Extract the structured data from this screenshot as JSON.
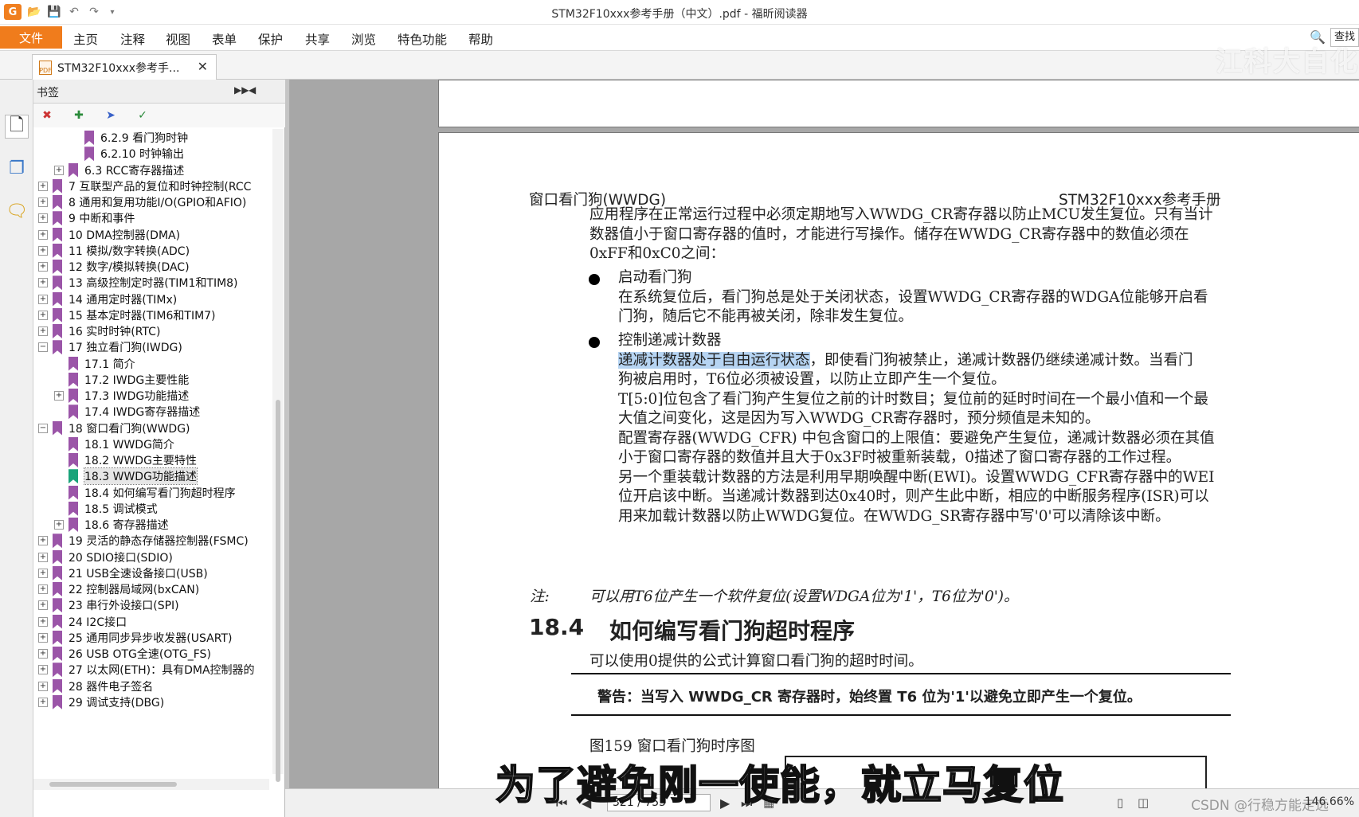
{
  "titlebar": {
    "app_icon": "G",
    "window_title": "STM32F10xxx参考手册（中文）.pdf - 福昕阅读器",
    "quick_access": [
      "open-folder-icon",
      "save-icon",
      "undo-icon",
      "redo-icon",
      "customize-icon"
    ]
  },
  "ribbon": {
    "file_tab": "文件",
    "tabs": [
      "主页",
      "注释",
      "视图",
      "表单",
      "保护",
      "共享",
      "浏览",
      "特色功能",
      "帮助"
    ],
    "search_label": "查找"
  },
  "doc_tab": {
    "title": "STM32F10xxx参考手...",
    "close": "✕"
  },
  "watermark_top": "江科大自化",
  "bookmarks": {
    "header": "书签",
    "items": [
      {
        "label": "6.2.9 看门狗时钟",
        "level": 3,
        "expandable": false
      },
      {
        "label": "6.2.10 时钟输出",
        "level": 3,
        "expandable": false
      },
      {
        "label": "6.3 RCC寄存器描述",
        "level": 2,
        "expandable": true
      },
      {
        "label": "7 互联型产品的复位和时钟控制(RCC",
        "level": 1,
        "expandable": true
      },
      {
        "label": "8 通用和复用功能I/O(GPIO和AFIO)",
        "level": 1,
        "expandable": true
      },
      {
        "label": "9 中断和事件",
        "level": 1,
        "expandable": true
      },
      {
        "label": "10 DMA控制器(DMA)",
        "level": 1,
        "expandable": true
      },
      {
        "label": "11 模拟/数字转换(ADC)",
        "level": 1,
        "expandable": true
      },
      {
        "label": "12 数字/模拟转换(DAC)",
        "level": 1,
        "expandable": true
      },
      {
        "label": "13 高级控制定时器(TIM1和TIM8)",
        "level": 1,
        "expandable": true
      },
      {
        "label": "14 通用定时器(TIMx)",
        "level": 1,
        "expandable": true
      },
      {
        "label": "15 基本定时器(TIM6和TIM7)",
        "level": 1,
        "expandable": true
      },
      {
        "label": "16 实时时钟(RTC)",
        "level": 1,
        "expandable": true
      },
      {
        "label": "17 独立看门狗(IWDG)",
        "level": 1,
        "expandable": true,
        "open": true
      },
      {
        "label": "17.1 简介",
        "level": 2,
        "expandable": false
      },
      {
        "label": "17.2 IWDG主要性能",
        "level": 2,
        "expandable": false
      },
      {
        "label": "17.3 IWDG功能描述",
        "level": 2,
        "expandable": true
      },
      {
        "label": "17.4 IWDG寄存器描述",
        "level": 2,
        "expandable": false
      },
      {
        "label": "18 窗口看门狗(WWDG)",
        "level": 1,
        "expandable": true,
        "open": true
      },
      {
        "label": "18.1 WWDG简介",
        "level": 2,
        "expandable": false
      },
      {
        "label": "18.2 WWDG主要特性",
        "level": 2,
        "expandable": false
      },
      {
        "label": "18.3 WWDG功能描述",
        "level": 2,
        "expandable": false,
        "selected": true
      },
      {
        "label": "18.4 如何编写看门狗超时程序",
        "level": 2,
        "expandable": false
      },
      {
        "label": "18.5 调试模式",
        "level": 2,
        "expandable": false
      },
      {
        "label": "18.6 寄存器描述",
        "level": 2,
        "expandable": true
      },
      {
        "label": "19 灵活的静态存储器控制器(FSMC)",
        "level": 1,
        "expandable": true
      },
      {
        "label": "20 SDIO接口(SDIO)",
        "level": 1,
        "expandable": true
      },
      {
        "label": "21 USB全速设备接口(USB)",
        "level": 1,
        "expandable": true
      },
      {
        "label": "22 控制器局域网(bxCAN)",
        "level": 1,
        "expandable": true
      },
      {
        "label": "23 串行外设接口(SPI)",
        "level": 1,
        "expandable": true
      },
      {
        "label": "24 I2C接口",
        "level": 1,
        "expandable": true
      },
      {
        "label": "25 通用同步异步收发器(USART)",
        "level": 1,
        "expandable": true
      },
      {
        "label": "26 USB OTG全速(OTG_FS)",
        "level": 1,
        "expandable": true
      },
      {
        "label": "27 以太网(ETH)：具有DMA控制器的",
        "level": 1,
        "expandable": true
      },
      {
        "label": "28 器件电子签名",
        "level": 1,
        "expandable": true
      },
      {
        "label": "29 调试支持(DBG)",
        "level": 1,
        "expandable": true
      }
    ]
  },
  "page": {
    "header_left": "窗口看门狗(WWDG)",
    "header_right": "STM32F10xxx参考手册",
    "intro": [
      "应用程序在正常运行过程中必须定期地写入WWDG_CR寄存器以防止MCU发生复位。只有当计",
      "数器值小于窗口寄存器的值时，才能进行写操作。储存在WWDG_CR寄存器中的数值必须在",
      "0xFF和0xC0之间："
    ],
    "bullet1_title": "启动看门狗",
    "bullet1_text": [
      "在系统复位后，看门狗总是处于关闭状态，设置WWDG_CR寄存器的WDGA位能够开启看",
      "门狗，随后它不能再被关闭，除非发生复位。"
    ],
    "bullet2_title": "控制递减计数器",
    "bullet2_highlight": "递减计数器处于自由运行状态",
    "bullet2_line1_rest": "，即使看门狗被禁止，递减计数器仍继续递减计数。当看门",
    "bullet2_text": [
      "狗被启用时，T6位必须被设置，以防止立即产生一个复位。",
      "T[5:0]位包含了看门狗产生复位之前的计时数目；复位前的延时时间在一个最小值和一个最",
      "大值之间变化，这是因为写入WWDG_CR寄存器时，预分频值是未知的。",
      "配置寄存器(WWDG_CFR) 中包含窗口的上限值：要避免产生复位，递减计数器必须在其值",
      "小于窗口寄存器的数值并且大于0x3F时被重新装载，0描述了窗口寄存器的工作过程。",
      "另一个重装载计数器的方法是利用早期唤醒中断(EWI)。设置WWDG_CFR寄存器中的WEI",
      "位开启该中断。当递减计数器到达0x40时，则产生此中断，相应的中断服务程序(ISR)可以",
      "用来加载计数器以防止WWDG复位。在WWDG_SR寄存器中写'0'可以清除该中断。"
    ],
    "note_label": "注:",
    "note_text": "可以用T6位产生一个软件复位(设置WDGA位为'1'，T6位为'0')。",
    "section_num": "18.4",
    "section_title": "如何编写看门狗超时程序",
    "section_text": "可以使用0提供的公式计算窗口看门狗的超时时间。",
    "warning": "警告：当写入 WWDG_CR 寄存器时，始终置 T6 位为'1'以避免立即产生一个复位。",
    "figure_caption": "图159    窗口看门狗时序图"
  },
  "status": {
    "page_display": "321 / 755",
    "zoom": "146.66%",
    "csdn": "CSDN @行稳方能走远"
  },
  "subtitle": "为了避免刚一使能，就立马复位"
}
